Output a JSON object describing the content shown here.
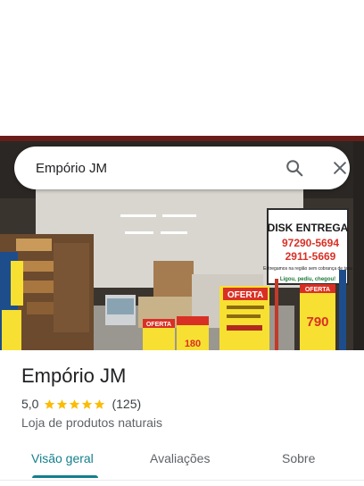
{
  "search": {
    "query": "Empório JM"
  },
  "photo": {
    "sign_delivery_title": "DISK ENTREGA",
    "sign_phone_1": "97290-5694",
    "sign_phone_2": "2911-5669",
    "sign_delivery_note": "Entregamos na região sem cobrança de taxa",
    "sign_slogan": "Ligou, pediu, chegou!",
    "sign_oferta": "OFERTA",
    "sign_price": "790",
    "sign_price_2": "180"
  },
  "place": {
    "name": "Empório JM",
    "rating": "5,0",
    "stars": 5,
    "review_count": "(125)",
    "category": "Loja de produtos naturais"
  },
  "tabs": [
    {
      "label": "Visão geral",
      "active": true
    },
    {
      "label": "Avaliações",
      "active": false
    },
    {
      "label": "Sobre",
      "active": false
    }
  ],
  "colors": {
    "accent": "#137f8c",
    "star": "#fbbc04",
    "oferta_red": "#d93025",
    "sign_yellow": "#f7e032"
  },
  "icons": {
    "search": "search-icon",
    "close": "close-icon",
    "star": "star-icon"
  }
}
